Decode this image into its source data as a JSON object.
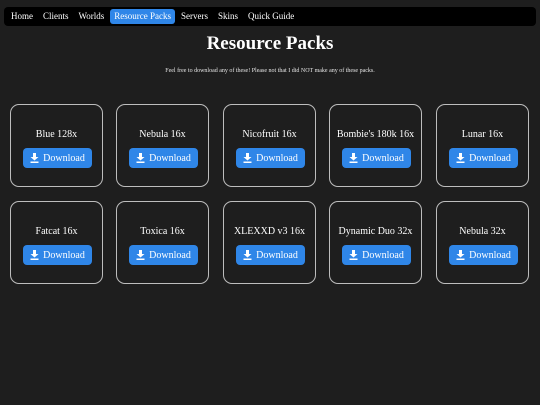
{
  "nav": {
    "items": [
      {
        "label": "Home",
        "active": false
      },
      {
        "label": "Clients",
        "active": false
      },
      {
        "label": "Worlds",
        "active": false
      },
      {
        "label": "Resource Packs",
        "active": true
      },
      {
        "label": "Servers",
        "active": false
      },
      {
        "label": "Skins",
        "active": false
      },
      {
        "label": "Quick Guide",
        "active": false
      }
    ]
  },
  "page": {
    "title": "Resource Packs",
    "subtitle": "Feel free to download any of these! Please not that I did NOT make any of these packs."
  },
  "packs": [
    {
      "name": "Blue 128x",
      "button": "Download"
    },
    {
      "name": "Nebula 16x",
      "button": "Download"
    },
    {
      "name": "Nicofruit 16x",
      "button": "Download"
    },
    {
      "name": "Bombie's 180k 16x",
      "button": "Download"
    },
    {
      "name": "Lunar 16x",
      "button": "Download"
    },
    {
      "name": "Fatcat 16x",
      "button": "Download"
    },
    {
      "name": "Toxica 16x",
      "button": "Download"
    },
    {
      "name": "XLEXXD v3 16x",
      "button": "Download"
    },
    {
      "name": "Dynamic Duo 32x",
      "button": "Download"
    },
    {
      "name": "Nebula 32x",
      "button": "Download"
    }
  ],
  "icons": {
    "download": "download-icon"
  },
  "colors": {
    "accent": "#2f86e8",
    "background": "#1e1e1e",
    "navbar": "#000000",
    "card_border": "#bdbdbd"
  }
}
